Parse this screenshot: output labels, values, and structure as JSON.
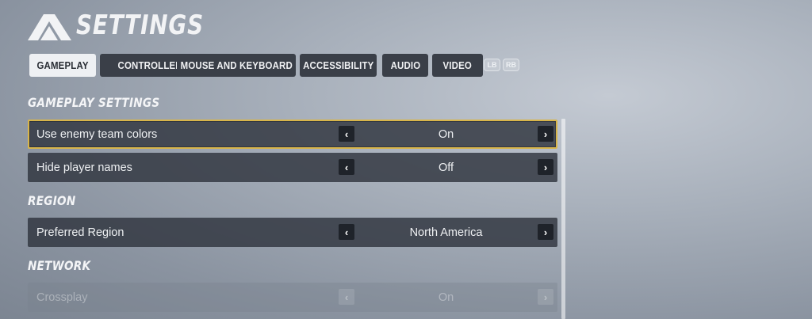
{
  "header": {
    "title": "SETTINGS"
  },
  "tabs": [
    {
      "label": "GAMEPLAY",
      "active": true
    },
    {
      "label": "CONTROLLER",
      "active": false
    },
    {
      "label": "MOUSE AND KEYBOARD",
      "active": false
    },
    {
      "label": "ACCESSIBILITY",
      "active": false
    },
    {
      "label": "AUDIO",
      "active": false
    },
    {
      "label": "VIDEO",
      "active": false
    }
  ],
  "bumpers": {
    "left": "LB",
    "right": "RB"
  },
  "sections": [
    {
      "title": "GAMEPLAY SETTINGS",
      "rows": [
        {
          "label": "Use enemy team colors",
          "value": "On",
          "focused": true,
          "disabled": false
        },
        {
          "label": "Hide player names",
          "value": "Off",
          "focused": false,
          "disabled": false
        }
      ]
    },
    {
      "title": "REGION",
      "rows": [
        {
          "label": "Preferred Region",
          "value": "North America",
          "focused": false,
          "disabled": false
        }
      ]
    },
    {
      "title": "NETWORK",
      "rows": [
        {
          "label": "Crossplay",
          "value": "On",
          "focused": false,
          "disabled": true
        }
      ]
    }
  ],
  "arrows": {
    "left": "‹",
    "right": "›"
  },
  "colors": {
    "focus_border": "#d8b54a",
    "row_bg": "#30353e",
    "active_tab_bg": "#eef0f3"
  }
}
